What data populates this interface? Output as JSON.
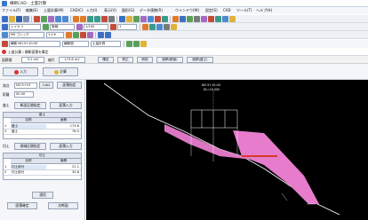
{
  "window": {
    "title": "横断CAD - 土量計算"
  },
  "menu": [
    "ファイル(F)",
    "編集(E)",
    "土量計算(M)",
    "CAD(C)",
    "入力(I)",
    "表示(V)",
    "図形(G)",
    "データ連携(R)",
    "ウインドウ(W)",
    "設定(S)",
    "CAD",
    "ツール(T)",
    "ヘルプ(H)"
  ],
  "toolbar2": {
    "layer": "レイヤ 1",
    "linetype": "実線",
    "scale": "1/100",
    "color": "1"
  },
  "toolbar3": {
    "font": "MS ゴシック",
    "size": "1.0 ▾"
  },
  "toolbar4": {
    "station": "横断 NO.5+10.00",
    "mode": "横断図",
    "item": "土量計算"
  },
  "header": {
    "section_label": "土量計算 / 横断面積を算定"
  },
  "status": {
    "area_label": "面積値",
    "area_value": "3.2 m2",
    "scale_label": "縮尺",
    "scale_value": "173.6 m2",
    "btn1": "確定",
    "btn2": "修正",
    "btn3": "削除",
    "btn4": "面積(断面)",
    "btn5": "面積(盛土)"
  },
  "left_panel": {
    "tab_input": "入力",
    "tab_calc": "計算",
    "station_label": "測点",
    "station_value": "NO.5+10",
    "cad_button": "CAD",
    "area_button": "面積指定",
    "distance_label": "距離",
    "distance_value": "50.00",
    "cut_label": "盛土",
    "cut_btn1": "断面区間指定",
    "cut_btn2": "面積入力",
    "cut_table": {
      "title": "盛土",
      "head_name": "名称",
      "head_area": "面積",
      "rows": [
        {
          "no": "1",
          "name": "盛土",
          "area": "173.6"
        },
        {
          "no": "2",
          "name": "盛土",
          "area": "76.5"
        }
      ]
    },
    "fill_label": "切土",
    "fill_btn1": "領域区間指定",
    "fill_btn2": "面積入力",
    "fill_table": {
      "title": "切土",
      "head_name": "名称",
      "head_area": "面積",
      "rows": [
        {
          "no": "1",
          "name": "切土部分",
          "area": "21.1"
        },
        {
          "no": "2",
          "name": "切土部分",
          "area": "35.8"
        }
      ]
    },
    "apply_button": "適用",
    "ok_button": "面積確定",
    "cancel_button": "次断面"
  },
  "canvas": {
    "label_top": "NO.5+10.00",
    "label_sub": "DL=10.000",
    "colors": {
      "background": "#000000",
      "fill": "#e77ccd",
      "cut": "#c9503a",
      "ground": "#ffffff",
      "frame": "#ffffff"
    }
  }
}
